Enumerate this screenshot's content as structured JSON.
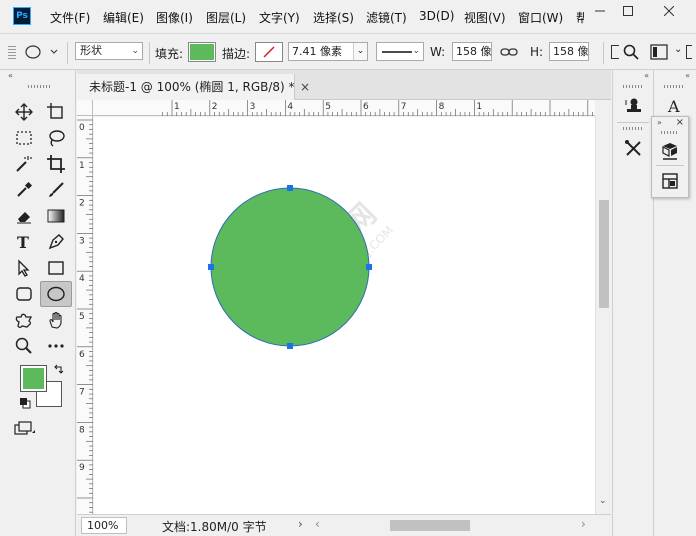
{
  "app": {
    "logo": "Ps"
  },
  "menu": [
    {
      "label": "文件(F)"
    },
    {
      "label": "编辑(E)"
    },
    {
      "label": "图像(I)"
    },
    {
      "label": "图层(L)"
    },
    {
      "label": "文字(Y)"
    },
    {
      "label": "选择(S)"
    },
    {
      "label": "滤镜(T)"
    },
    {
      "label": "3D(D)"
    },
    {
      "label": "视图(V)"
    },
    {
      "label": "窗口(W)"
    },
    {
      "label": "帮"
    }
  ],
  "options": {
    "mode_select": "形状",
    "fill_label": "填充:",
    "fill_color": "#5cba5c",
    "stroke_label": "描边:",
    "stroke_width": "7.41 像素",
    "w_label": "W:",
    "w_value": "158 像",
    "h_label": "H:",
    "h_value": "158 像"
  },
  "document": {
    "tab_title": "未标题-1 @ 100% (椭圆 1, RGB/8) *",
    "zoom": "100%",
    "doc_info": "文档:1.80M/0 字节",
    "ruler_top": [
      "1",
      "2",
      "3",
      "4",
      "5",
      "6",
      "7",
      "8",
      "1"
    ],
    "ruler_left": [
      "0",
      "1",
      "2",
      "3",
      "4",
      "5",
      "6",
      "7",
      "8",
      "9"
    ],
    "shape_color": "#5cba5c",
    "shape_stroke": "#2e6db4",
    "handle_color": "#1a73e8"
  },
  "colors": {
    "foreground": "#5cba5c",
    "background": "#ffffff"
  }
}
